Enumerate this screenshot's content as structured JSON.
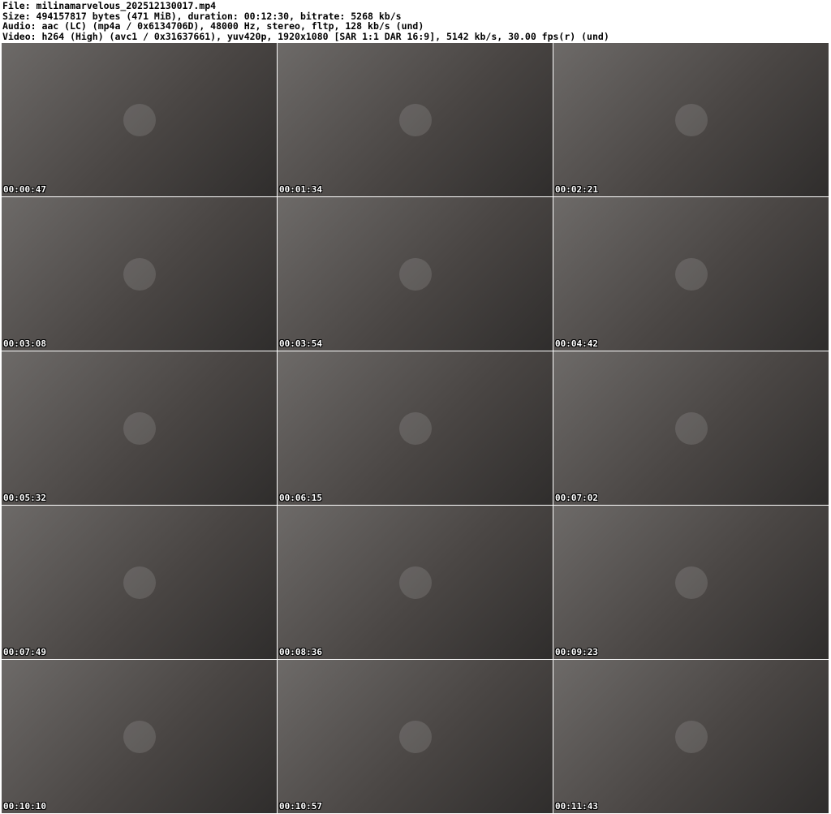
{
  "header": {
    "file": "File: milinamarvelous_202512130017.mp4",
    "size": "Size: 494157817 bytes (471 MiB), duration: 00:12:30, bitrate: 5268 kb/s",
    "audio": "Audio: aac (LC) (mp4a / 0x6134706D), 48000 Hz, stereo, fltp, 128 kb/s (und)",
    "video": "Video: h264 (High) (avc1 / 0x31637661), yuv420p, 1920x1080 [SAR 1:1 DAR 16:9], 5142 kb/s, 30.00 fps(r) (und)"
  },
  "thumbnails": [
    {
      "timestamp": "00:00:47"
    },
    {
      "timestamp": "00:01:34"
    },
    {
      "timestamp": "00:02:21"
    },
    {
      "timestamp": "00:03:08"
    },
    {
      "timestamp": "00:03:54"
    },
    {
      "timestamp": "00:04:42"
    },
    {
      "timestamp": "00:05:32"
    },
    {
      "timestamp": "00:06:15"
    },
    {
      "timestamp": "00:07:02"
    },
    {
      "timestamp": "00:07:49"
    },
    {
      "timestamp": "00:08:36"
    },
    {
      "timestamp": "00:09:23"
    },
    {
      "timestamp": "00:10:10"
    },
    {
      "timestamp": "00:10:57"
    },
    {
      "timestamp": "00:11:43"
    }
  ]
}
